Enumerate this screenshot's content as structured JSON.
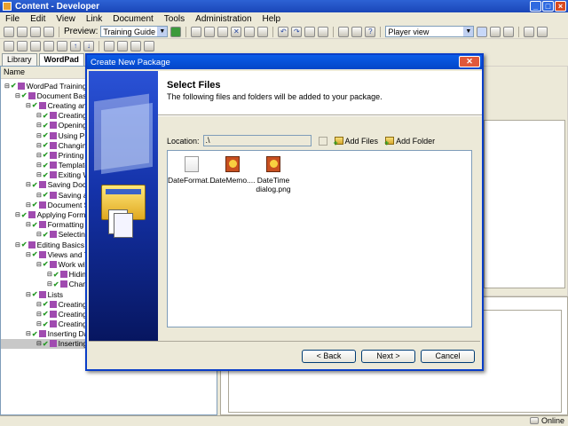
{
  "window": {
    "title": "Content - Developer"
  },
  "menu": [
    "File",
    "Edit",
    "View",
    "Link",
    "Document",
    "Tools",
    "Administration",
    "Help"
  ],
  "toolbar": {
    "preview_label": "Preview:",
    "preview_value": "Training Guide",
    "view_value": "Player view"
  },
  "tabs": [
    "Library",
    "WordPad"
  ],
  "tree": {
    "header": "Name",
    "items": [
      {
        "label": "WordPad Training",
        "indent": 0,
        "selected": false
      },
      {
        "label": "Document Basics",
        "indent": 1,
        "selected": false
      },
      {
        "label": "Creating and",
        "indent": 2,
        "selected": false
      },
      {
        "label": "Creating a",
        "indent": 3,
        "selected": false
      },
      {
        "label": "Opening a",
        "indent": 3,
        "selected": false
      },
      {
        "label": "Using Prin",
        "indent": 3,
        "selected": false
      },
      {
        "label": "Changing",
        "indent": 3,
        "selected": false
      },
      {
        "label": "Printing a",
        "indent": 3,
        "selected": false
      },
      {
        "label": "Templates",
        "indent": 3,
        "selected": false
      },
      {
        "label": "Exiting W",
        "indent": 3,
        "selected": false
      },
      {
        "label": "Saving Docum",
        "indent": 2,
        "selected": false
      },
      {
        "label": "Saving a",
        "indent": 3,
        "selected": false
      },
      {
        "label": "Document Se",
        "indent": 2,
        "selected": false
      },
      {
        "label": "Applying Formatt",
        "indent": 1,
        "selected": false
      },
      {
        "label": "Formatting Pa",
        "indent": 2,
        "selected": false
      },
      {
        "label": "Selecting",
        "indent": 3,
        "selected": false
      },
      {
        "label": "Editing Basics",
        "indent": 1,
        "selected": false
      },
      {
        "label": "Views and To",
        "indent": 2,
        "selected": false
      },
      {
        "label": "Work with",
        "indent": 3,
        "selected": false
      },
      {
        "label": "Hiding",
        "indent": 4,
        "selected": false
      },
      {
        "label": "Chang",
        "indent": 4,
        "selected": false
      },
      {
        "label": "Lists",
        "indent": 2,
        "selected": false
      },
      {
        "label": "Creating",
        "indent": 3,
        "selected": false
      },
      {
        "label": "Creating",
        "indent": 3,
        "selected": false
      },
      {
        "label": "Creating",
        "indent": 3,
        "selected": false
      },
      {
        "label": "Inserting Dat",
        "indent": 2,
        "selected": false
      },
      {
        "label": "Inserting",
        "indent": 3,
        "selected": true
      }
    ]
  },
  "status": {
    "online": "Online"
  },
  "dialog": {
    "title": "Create New Package",
    "heading": "Select Files",
    "subheading": "The following files and folders will be added to your package.",
    "location_label": "Location:",
    "location_value": ".\\",
    "add_files": "Add Files",
    "add_folder": "Add Folder",
    "files": [
      {
        "name": "DateFormat....",
        "type": "txt"
      },
      {
        "name": "DateMemo....",
        "type": "img"
      },
      {
        "name": "DateTime dialog.png",
        "type": "img"
      }
    ],
    "back": "< Back",
    "next": "Next >",
    "cancel": "Cancel"
  }
}
